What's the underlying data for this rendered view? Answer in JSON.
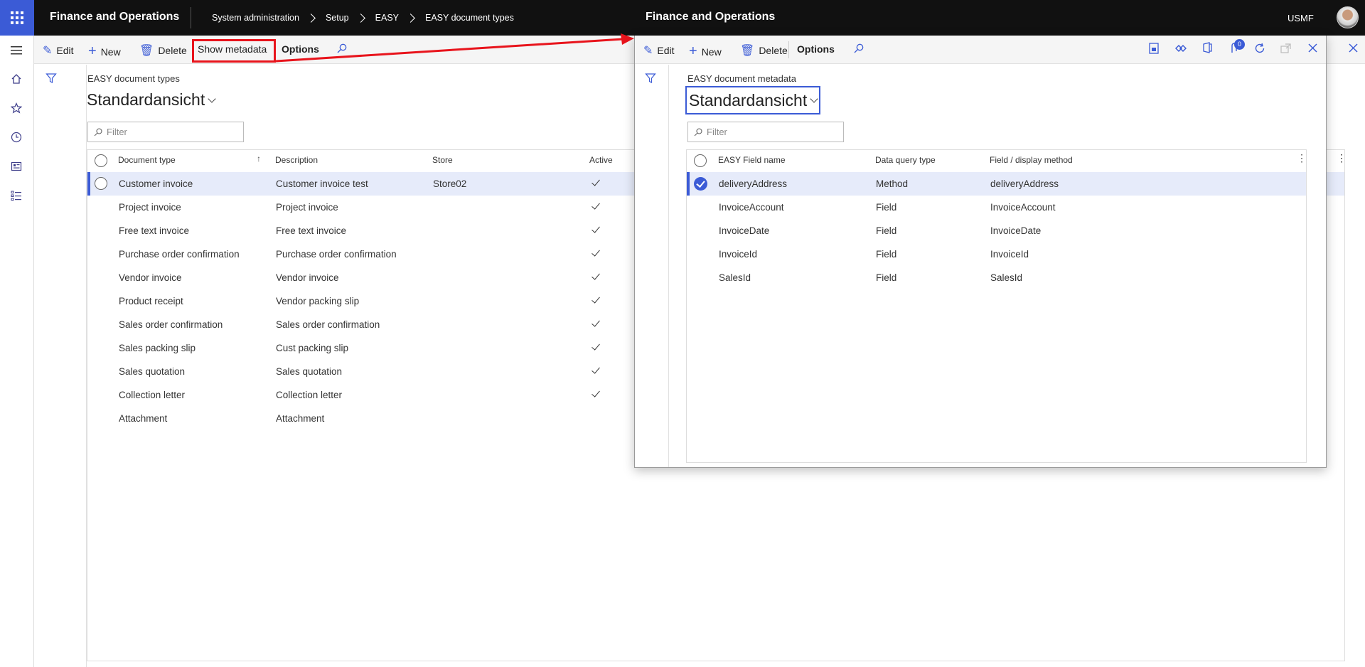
{
  "app": {
    "title": "Finance and Operations",
    "company": "USMF"
  },
  "breadcrumb": [
    "System administration",
    "Setup",
    "EASY",
    "EASY document types"
  ],
  "toolbar": {
    "edit": "Edit",
    "new": "New",
    "delete": "Delete",
    "show_metadata": "Show metadata",
    "options": "Options"
  },
  "main": {
    "caption": "EASY document types",
    "view": "Standardansicht",
    "filter_placeholder": "Filter",
    "columns": [
      "Document type",
      "Description",
      "Store",
      "Active"
    ],
    "rows": [
      {
        "type": "Customer invoice",
        "description": "Customer invoice test",
        "store": "Store02",
        "active": true
      },
      {
        "type": "Project invoice",
        "description": "Project invoice",
        "store": "",
        "active": true
      },
      {
        "type": "Free text invoice",
        "description": "Free text invoice",
        "store": "",
        "active": true
      },
      {
        "type": "Purchase order confirmation",
        "description": "Purchase order confirmation",
        "store": "",
        "active": true
      },
      {
        "type": "Vendor invoice",
        "description": "Vendor invoice",
        "store": "",
        "active": true
      },
      {
        "type": "Product receipt",
        "description": "Vendor packing slip",
        "store": "",
        "active": true
      },
      {
        "type": "Sales order confirmation",
        "description": "Sales order confirmation",
        "store": "",
        "active": true
      },
      {
        "type": "Sales packing slip",
        "description": "Cust packing slip",
        "store": "",
        "active": true
      },
      {
        "type": "Sales quotation",
        "description": "Sales quotation",
        "store": "",
        "active": true
      },
      {
        "type": "Collection letter",
        "description": "Collection letter",
        "store": "",
        "active": true
      },
      {
        "type": "Attachment",
        "description": "Attachment",
        "store": "",
        "active": false
      }
    ]
  },
  "dialog": {
    "title": "Finance and Operations",
    "toolbar": {
      "edit": "Edit",
      "new": "New",
      "delete": "Delete",
      "options": "Options"
    },
    "notification_count": "0",
    "caption": "EASY document metadata",
    "view": "Standardansicht",
    "filter_placeholder": "Filter",
    "columns": [
      "EASY Field name",
      "Data query type",
      "Field / display method"
    ],
    "rows": [
      {
        "field": "deliveryAddress",
        "query_type": "Method",
        "method": "deliveryAddress"
      },
      {
        "field": "InvoiceAccount",
        "query_type": "Field",
        "method": "InvoiceAccount"
      },
      {
        "field": "InvoiceDate",
        "query_type": "Field",
        "method": "InvoiceDate"
      },
      {
        "field": "InvoiceId",
        "query_type": "Field",
        "method": "InvoiceId"
      },
      {
        "field": "SalesId",
        "query_type": "Field",
        "method": "SalesId"
      }
    ]
  },
  "colors": {
    "accent": "#3b5bd6",
    "topbar": "#111111",
    "annotation": "#e8141c"
  }
}
